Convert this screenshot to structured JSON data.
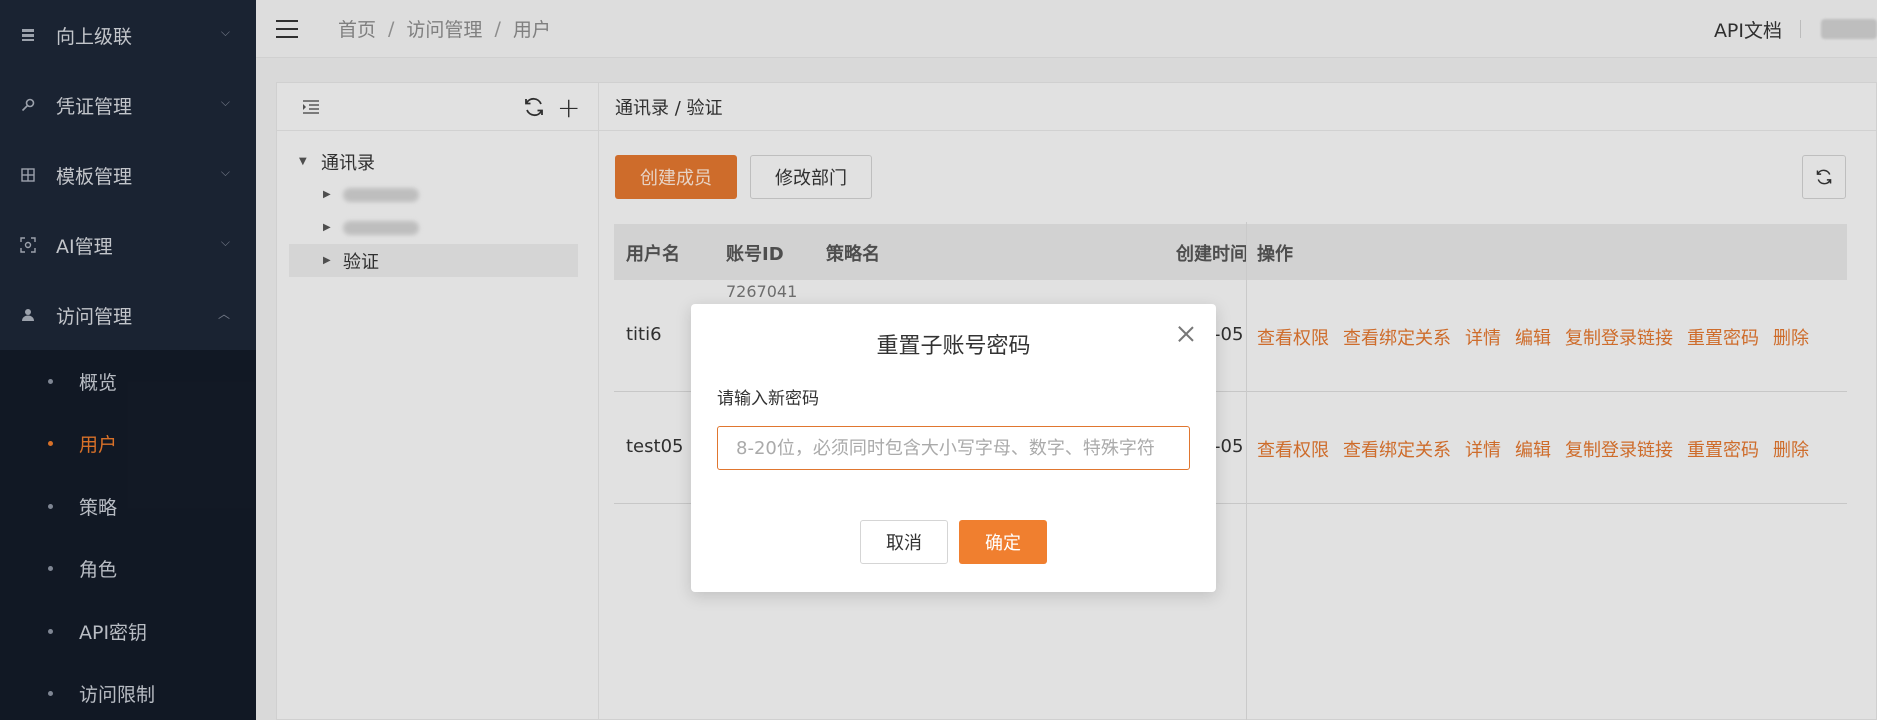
{
  "sidebar": {
    "groups": [
      {
        "label": "向上级联",
        "icon": "server-icon"
      },
      {
        "label": "凭证管理",
        "icon": "key-icon"
      },
      {
        "label": "模板管理",
        "icon": "grid-icon"
      },
      {
        "label": "AI管理",
        "icon": "ai-icon"
      },
      {
        "label": "访问管理",
        "icon": "user-icon"
      }
    ],
    "sub_items": [
      {
        "label": "概览"
      },
      {
        "label": "用户"
      },
      {
        "label": "策略"
      },
      {
        "label": "角色"
      },
      {
        "label": "API密钥"
      },
      {
        "label": "访问限制"
      }
    ],
    "active_sub_item": "用户"
  },
  "header": {
    "breadcrumb": [
      "首页",
      "访问管理",
      "用户"
    ],
    "separator": "/",
    "api_doc": "API文档"
  },
  "tree": {
    "root": "通讯录",
    "selected": "验证"
  },
  "right_panel": {
    "path": "通讯录 / 验证",
    "create_button": "创建成员",
    "dept_button": "修改部门"
  },
  "table": {
    "headers": {
      "username": "用户名",
      "account_id": "账号ID",
      "policy": "策略名",
      "created": "创建时间",
      "ops": "操作"
    },
    "rows": [
      {
        "username": "titi6",
        "id_peek": "7267041",
        "time_tail": "-05"
      },
      {
        "username": "test05",
        "id_peek": "",
        "time_tail": "-05"
      }
    ],
    "actions": [
      "查看权限",
      "查看绑定关系",
      "详情",
      "编辑",
      "复制登录链接",
      "重置密码",
      "删除"
    ]
  },
  "modal": {
    "title": "重置子账号密码",
    "label": "请输入新密码",
    "placeholder": "8-20位，必须同时包含大小写字母、数字、特殊字符",
    "cancel": "取消",
    "confirm": "确定"
  },
  "colors": {
    "accent": "#e0762f",
    "sidebar_bg": "#1d2637",
    "submenu_bg": "#131b28"
  }
}
